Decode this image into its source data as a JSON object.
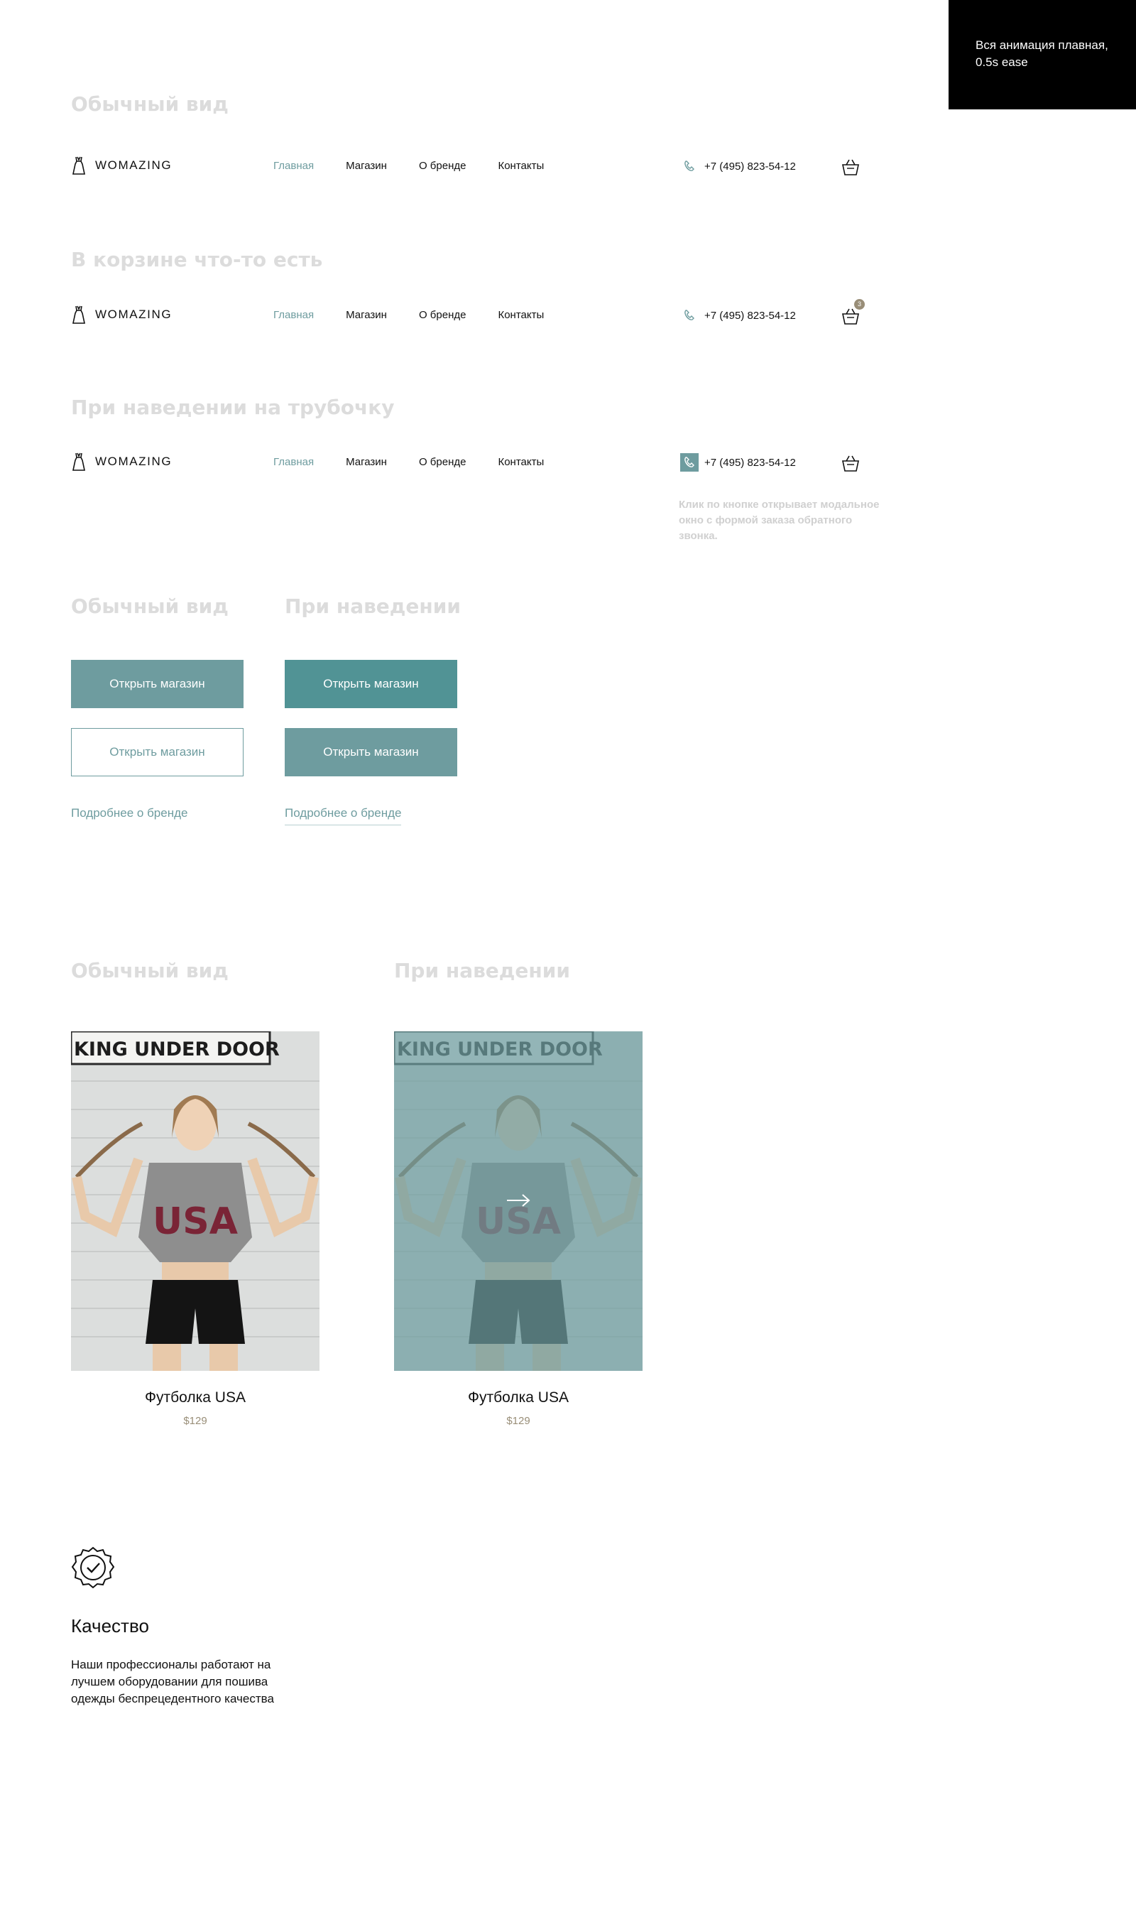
{
  "note": {
    "text": "Вся анимация плавная, 0.5s ease"
  },
  "header": {
    "logo": "WOMAZING",
    "nav": [
      "Главная",
      "Магазин",
      "О бренде",
      "Контакты"
    ],
    "phone": "+7 (495) 823-54-12",
    "cart_count": "3"
  },
  "sections": {
    "header_normal": "Обычный вид",
    "header_cart": "В корзине что-то есть",
    "header_hover_phone": "При наведении на трубочку",
    "buttons_normal": "Обычный вид",
    "buttons_hover": "При наведении",
    "cards_normal": "Обычный вид",
    "cards_hover": "При наведении"
  },
  "phone_hint": "Клик по кнопке открывает модальное окно с формой заказа обратного звонка.",
  "buttons": {
    "primary": "Открыть магазин",
    "secondary": "Открыть магазин",
    "link": "Подробнее о бренде"
  },
  "product": {
    "name": "Футболка USA",
    "price": "$129",
    "sign_text": "KING UNDER DOOR",
    "shirt_text": "USA"
  },
  "quality": {
    "title": "Качество",
    "text": "Наши профессионалы работают на лучшем оборудовании для пошива одежды беспрецедентного качества"
  },
  "colors": {
    "accent": "#6e9c9f",
    "accent_hover": "#519395",
    "price": "#998e78",
    "section_title": "#dcdcdc"
  }
}
